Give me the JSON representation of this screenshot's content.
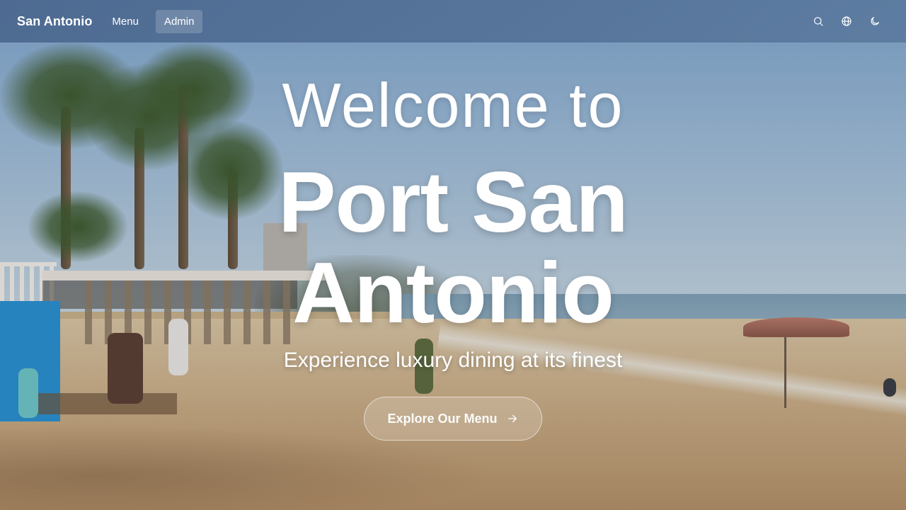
{
  "navbar": {
    "brand": "San Antonio",
    "links": [
      {
        "label": "Menu",
        "active": false
      },
      {
        "label": "Admin",
        "active": true
      }
    ],
    "icons": [
      "search-icon",
      "globe-icon",
      "moon-icon"
    ]
  },
  "hero": {
    "welcome": "Welcome to",
    "title_line1": "Port San",
    "title_line2": "Antonio",
    "tagline": "Experience luxury dining at its finest",
    "cta_label": "Explore Our Menu",
    "cta_icon": "arrow-right-icon",
    "background": "beach-photo"
  },
  "colors": {
    "navbar": "#4d6d96",
    "text": "#ffffff"
  }
}
